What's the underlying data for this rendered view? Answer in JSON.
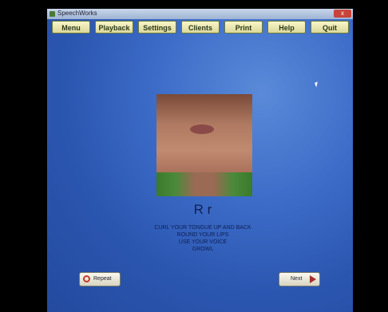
{
  "window": {
    "title": "SpeechWorks"
  },
  "menu": {
    "items": [
      {
        "label": "Menu"
      },
      {
        "label": "Playback"
      },
      {
        "label": "Settings"
      },
      {
        "label": "Clients"
      },
      {
        "label": "Print"
      },
      {
        "label": "Help"
      },
      {
        "label": "Quit"
      }
    ]
  },
  "lesson": {
    "letter": "R r",
    "instructions": [
      "CURL YOUR TONGUE UP AND BACK",
      "ROUND YOUR LIPS",
      "USE YOUR VOICE",
      "GROWL"
    ]
  },
  "buttons": {
    "repeat": "Repeat",
    "next": "Next"
  },
  "icons": {
    "repeat": "repeat-icon",
    "next": "next-arrow-icon",
    "close": "close-icon"
  }
}
